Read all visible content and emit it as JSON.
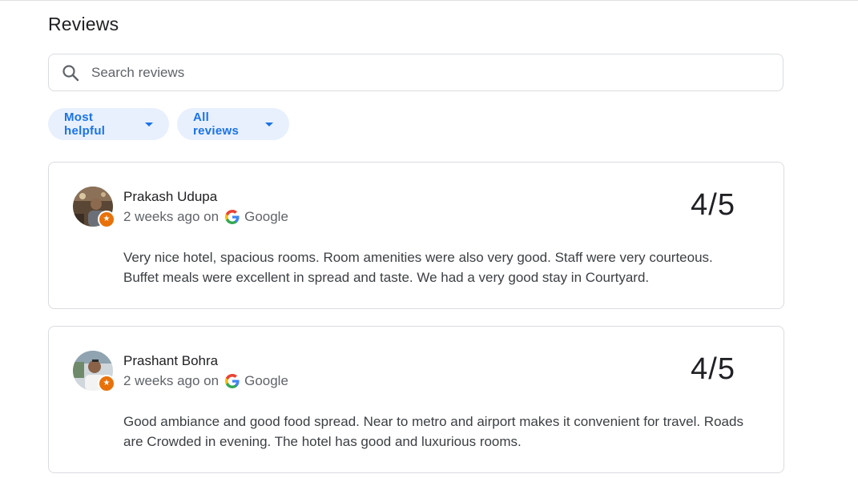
{
  "title": "Reviews",
  "search": {
    "placeholder": "Search reviews",
    "icon": "search-icon"
  },
  "filters": [
    {
      "label": "Most helpful"
    },
    {
      "label": "All reviews"
    }
  ],
  "colors": {
    "accent": "#1a73e8",
    "chip_bg": "#e8f0fe",
    "badge": "#e8710a"
  },
  "reviews": [
    {
      "name": "Prakash Udupa",
      "time": "2 weeks ago on",
      "source": "Google",
      "rating": "4/5",
      "text": "Very nice hotel, spacious rooms. Room amenities were also very good. Staff were very courteous. Buffet meals were excellent in spread and taste. We had a very good stay in Courtyard."
    },
    {
      "name": "Prashant Bohra",
      "time": "2 weeks ago on",
      "source": "Google",
      "rating": "4/5",
      "text": "Good ambiance and good food spread. Near to metro and airport makes it convenient for travel. Roads are Crowded in evening. The hotel has good and luxurious rooms."
    }
  ]
}
